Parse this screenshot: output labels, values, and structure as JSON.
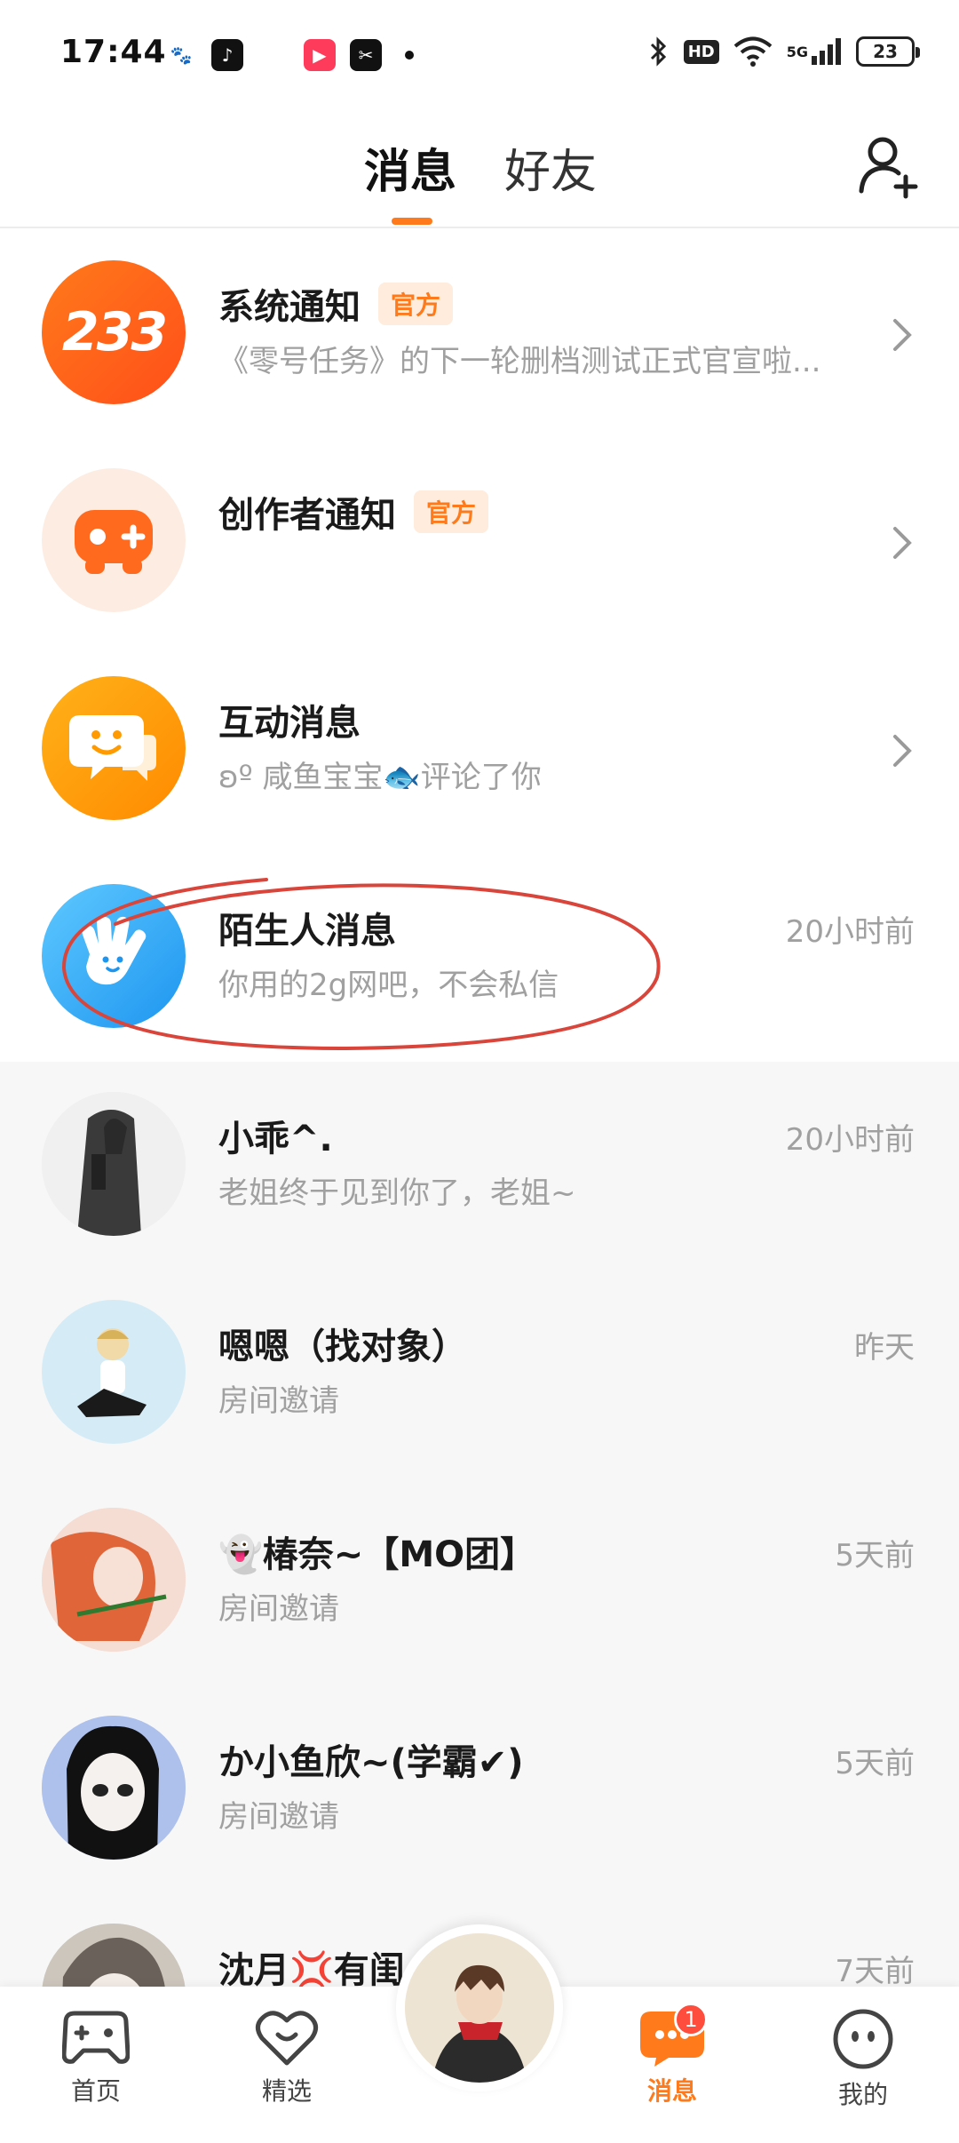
{
  "status_bar": {
    "time": "17:44",
    "network": "5G",
    "hd": "HD",
    "battery": "23",
    "app_icons": [
      "baidu-icon",
      "tiktok-icon",
      "monkey-icon",
      "video-icon",
      "capcut-icon"
    ]
  },
  "header": {
    "tab_messages": "消息",
    "tab_friends": "好友",
    "active_tab": "消息",
    "add_friend_icon": "add-friend-icon",
    "accent_color": "#ff7a1a"
  },
  "rows": [
    {
      "title": "系统通知",
      "badge": "官方",
      "subtitle": "《零号任务》的下一轮删档测试正式官宣啦...",
      "time": "",
      "avatar_text": "233"
    },
    {
      "title": "创作者通知",
      "badge": "官方",
      "subtitle": "",
      "time": ""
    },
    {
      "title": "互动消息",
      "badge": "",
      "subtitle": "ʚº 咸鱼宝宝🐟评论了你",
      "time": ""
    },
    {
      "title": "陌生人消息",
      "badge": "",
      "subtitle": "你用的2g网吧，不会私信",
      "time": "20小时前"
    },
    {
      "title": "小乖^.",
      "subtitle": "老姐终于见到你了，老姐~",
      "time": "20小时前"
    },
    {
      "title": "嗯嗯（找对象）",
      "subtitle": "房间邀请",
      "time": "昨天"
    },
    {
      "title": "👻椿奈~【MO团】",
      "subtitle": "房间邀请",
      "time": "5天前"
    },
    {
      "title": "か小鱼欣~(学霸✔)",
      "subtitle": "房间邀请",
      "time": "5天前"
    },
    {
      "title": "沈月💢有闺",
      "subtitle": "",
      "time": "7天前"
    }
  ],
  "bottom_nav": {
    "home": "首页",
    "featured": "精选",
    "messages": "消息",
    "me": "我的",
    "messages_badge": "1"
  }
}
